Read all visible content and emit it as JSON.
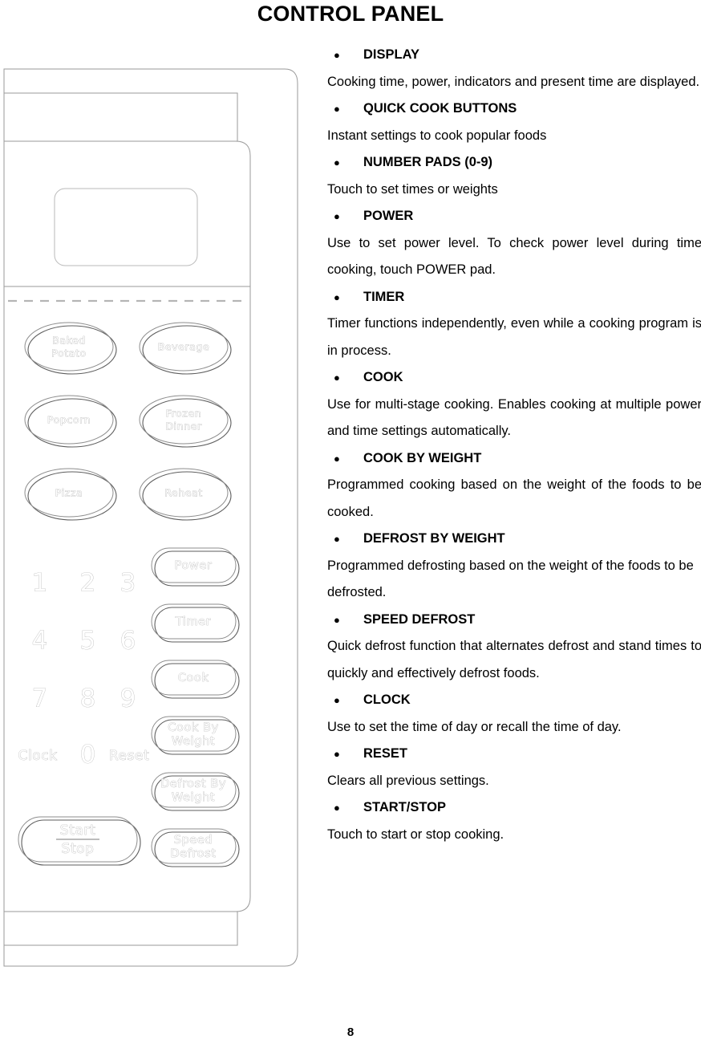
{
  "page": {
    "title": "CONTROL PANEL",
    "number": "8"
  },
  "features": [
    {
      "name": "DISPLAY",
      "description": "Cooking time, power, indicators and present time are displayed."
    },
    {
      "name": "QUICK COOK BUTTONS",
      "description": "Instant settings to cook popular foods"
    },
    {
      "name": "NUMBER PADS (0-9)",
      "description": "Touch to set times or weights"
    },
    {
      "name": "POWER",
      "description": "Use to set power level. To check power level during time cooking, touch POWER pad."
    },
    {
      "name": "TIMER",
      "description": "Timer functions independently, even while a cooking program is in process."
    },
    {
      "name": "COOK",
      "description": "Use for multi-stage cooking.   Enables cooking at multiple power and time settings automatically."
    },
    {
      "name": "COOK BY WEIGHT",
      "description": "Programmed cooking based on the weight of the foods to be cooked."
    },
    {
      "name": "DEFROST BY WEIGHT",
      "description": "Programmed defrosting based on the weight of the foods to be defrosted."
    },
    {
      "name": "SPEED DEFROST",
      "description": "Quick defrost function that alternates defrost and stand times to quickly and effectively defrost foods."
    },
    {
      "name": "CLOCK",
      "description": "Use to set the time of day or recall the time of day."
    },
    {
      "name": "RESET",
      "description": "Clears all previous settings."
    },
    {
      "name": "START/STOP",
      "description": "Touch to start or stop cooking."
    }
  ],
  "bullet_glyph": "●",
  "control_panel_figure": {
    "quick_cook_buttons": [
      {
        "line1": "Baked",
        "line2": "Potato"
      },
      {
        "line1": "Beverage",
        "line2": ""
      },
      {
        "line1": "Popcorn",
        "line2": ""
      },
      {
        "line1": "Frozen",
        "line2": "Dinner"
      },
      {
        "line1": "Pizza",
        "line2": ""
      },
      {
        "line1": "Reheat",
        "line2": ""
      }
    ],
    "number_pads": [
      "1",
      "2",
      "3",
      "4",
      "5",
      "6",
      "7",
      "8",
      "9"
    ],
    "clock_label": "Clock",
    "zero_label": "0",
    "reset_label": "Reset",
    "function_buttons": [
      {
        "line1": "Power",
        "line2": ""
      },
      {
        "line1": "Timer",
        "line2": ""
      },
      {
        "line1": "Cook",
        "line2": ""
      },
      {
        "line1": "Cook By",
        "line2": "Weight"
      },
      {
        "line1": "Defrost By",
        "line2": "Weight"
      },
      {
        "line1": "Speed",
        "line2": "Defrost"
      }
    ],
    "start_stop": {
      "line1": "Start",
      "line2": "Stop"
    }
  },
  "colors": {
    "outline": "#9a9a9a",
    "outline_dark": "#767676",
    "face_text_stroke": "#a6a6a6",
    "dashed_line": "#b5b5b5",
    "text": "#000000"
  }
}
